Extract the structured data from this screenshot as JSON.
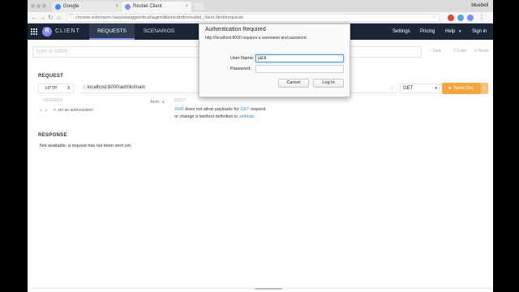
{
  "browser": {
    "tabs": [
      {
        "title": "Google",
        "favicon": "google-icon",
        "active": false
      },
      {
        "title": "Restlet Client",
        "favicon": "restlet-icon",
        "active": true
      }
    ],
    "close_glyph": "×",
    "profile_name": "bluebell",
    "address": "chrome-extension://aejoelaoggembcahagimdiliamlcdmfm/restlet_client.html#requests"
  },
  "app": {
    "logo_letter": "R",
    "brand": "CLIENT",
    "nav_tabs": [
      "REQUESTS",
      "SCENARIOS"
    ],
    "right_links": {
      "settings": "Settings",
      "pricing": "Pricing",
      "help": "Help",
      "help_caret": "▾",
      "signin": "Sign in"
    },
    "accent_color": "#7d8df0",
    "header_color": "#1b2737"
  },
  "request": {
    "name_placeholder": "type a name",
    "toolbar": {
      "save": "Save",
      "code": "2 Code",
      "reset": "Reset"
    },
    "section_label": "REQUEST",
    "protocol": "HTTP",
    "protocol_caret": "⇕",
    "url_prefix": "://",
    "url": "localhost:8000/admin/main",
    "method": "GET",
    "method_caret": "▾",
    "send_label": "Send (2s)",
    "send_caret": "▾",
    "send_color": "#f3a640",
    "headers_hint": "HEADERS",
    "auth_hint": "+, set an authorization",
    "body_type": "form",
    "body_caret": "▾",
    "body_hint": "BODY",
    "xhr_note": {
      "xhr": "XHR",
      "part1": " does not allow payloads for ",
      "method": "GET",
      "part2": " request.",
      "line2": "or change a method definition in ",
      "settings_link": "settings",
      "end": "."
    }
  },
  "response": {
    "section_label": "RESPONSE",
    "message": "Not available, a request has not been sent yet."
  },
  "auth_dialog": {
    "title": "Authentication Required",
    "message": "http://localhost:8000 requires a username and password.",
    "username_label": "User Name:",
    "username_value": "jack",
    "password_label": "Password:",
    "password_value": "",
    "cancel_label": "Cancel",
    "login_label": "Log In"
  }
}
